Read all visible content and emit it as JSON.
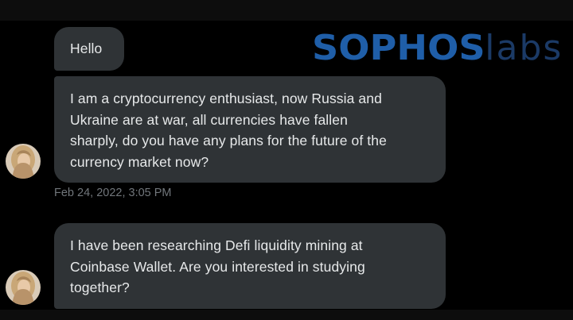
{
  "logo": {
    "brand_bold": "SOPHOS",
    "brand_light": "labs",
    "brand_bold_color": "#1f5ea8",
    "brand_light_color": "#1b3a66"
  },
  "conversation": {
    "messages": [
      {
        "text": "Hello"
      },
      {
        "lines": [
          "I am a cryptocurrency enthusiast, now Russia and",
          "Ukraine are at war, all currencies have fallen",
          "sharply, do you have any plans for the future of the",
          "currency market now?"
        ]
      },
      {
        "lines": [
          "I have been researching Defi liquidity mining at",
          "Coinbase Wallet. Are you interested in studying",
          "together?"
        ]
      }
    ],
    "timestamp": "Feb 24, 2022, 3:05 PM"
  },
  "colors": {
    "background": "#000000",
    "bubble": "#2f3336",
    "text": "#e7e9ea",
    "timestamp": "#71767b"
  }
}
